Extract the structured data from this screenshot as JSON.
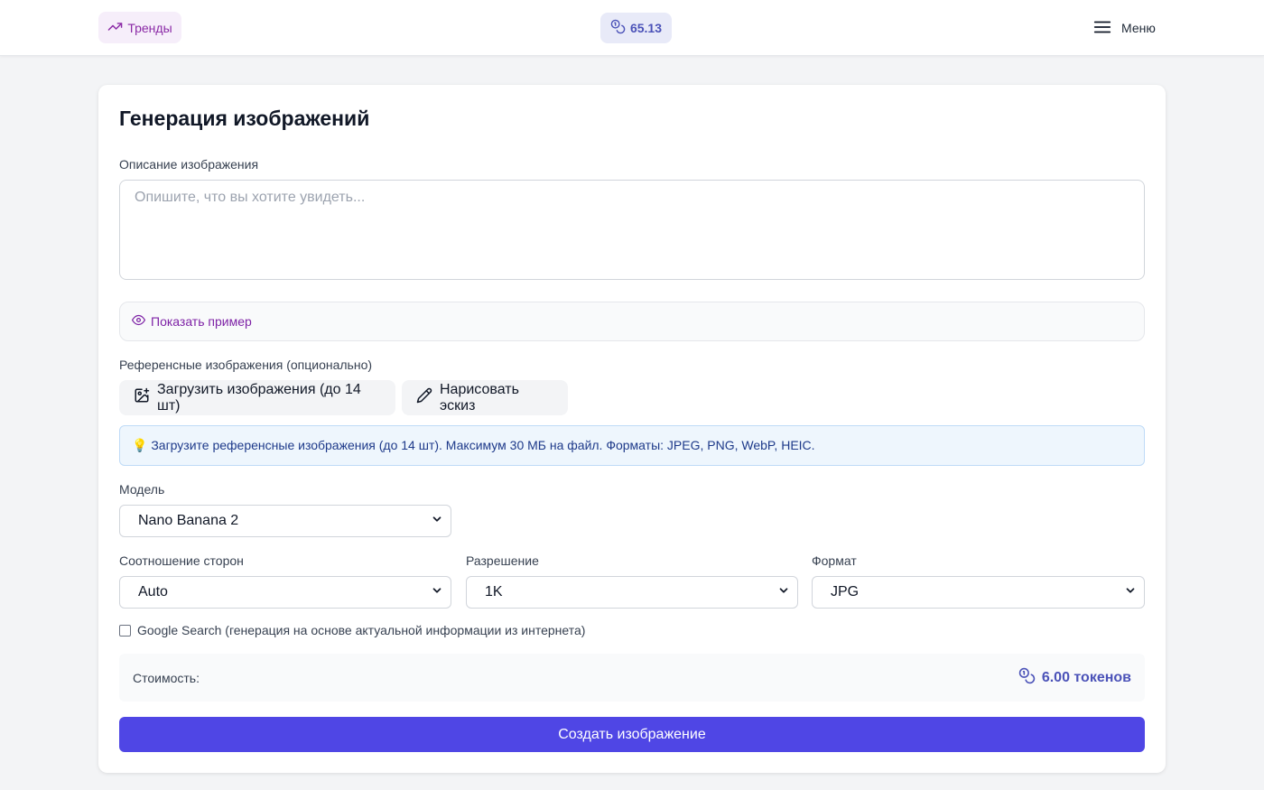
{
  "header": {
    "trends_label": "Тренды",
    "balance_value": "65.13",
    "menu_label": "Меню"
  },
  "form": {
    "title": "Генерация изображений",
    "description_label": "Описание изображения",
    "description_placeholder": "Опишите, что вы хотите увидеть...",
    "description_value": "",
    "show_example_label": "Показать пример",
    "references_label": "Референсные изображения (опционально)",
    "upload_button_label": "Загрузить изображения (до 14 шт)",
    "sketch_button_label": "Нарисовать эскиз",
    "info_text": "💡 Загрузите референсные изображения (до 14 шт). Максимум 30 МБ на файл. Форматы: JPEG, PNG, WebP, HEIC.",
    "model_label": "Модель",
    "model_value": "Nano Banana 2",
    "aspect_label": "Соотношение сторон",
    "aspect_value": "Auto",
    "resolution_label": "Разрешение",
    "resolution_value": "1K",
    "format_label": "Формат",
    "format_value": "JPG",
    "google_search_label": "Google Search (генерация на основе актуальной информации из интернета)",
    "google_search_checked": false,
    "cost_label": "Стоимость:",
    "cost_value": "6.00 токенов",
    "submit_label": "Создать изображение"
  },
  "colors": {
    "accent": "#4f46e5",
    "trends": "#8b2aa6",
    "balance": "#4b52b8"
  }
}
